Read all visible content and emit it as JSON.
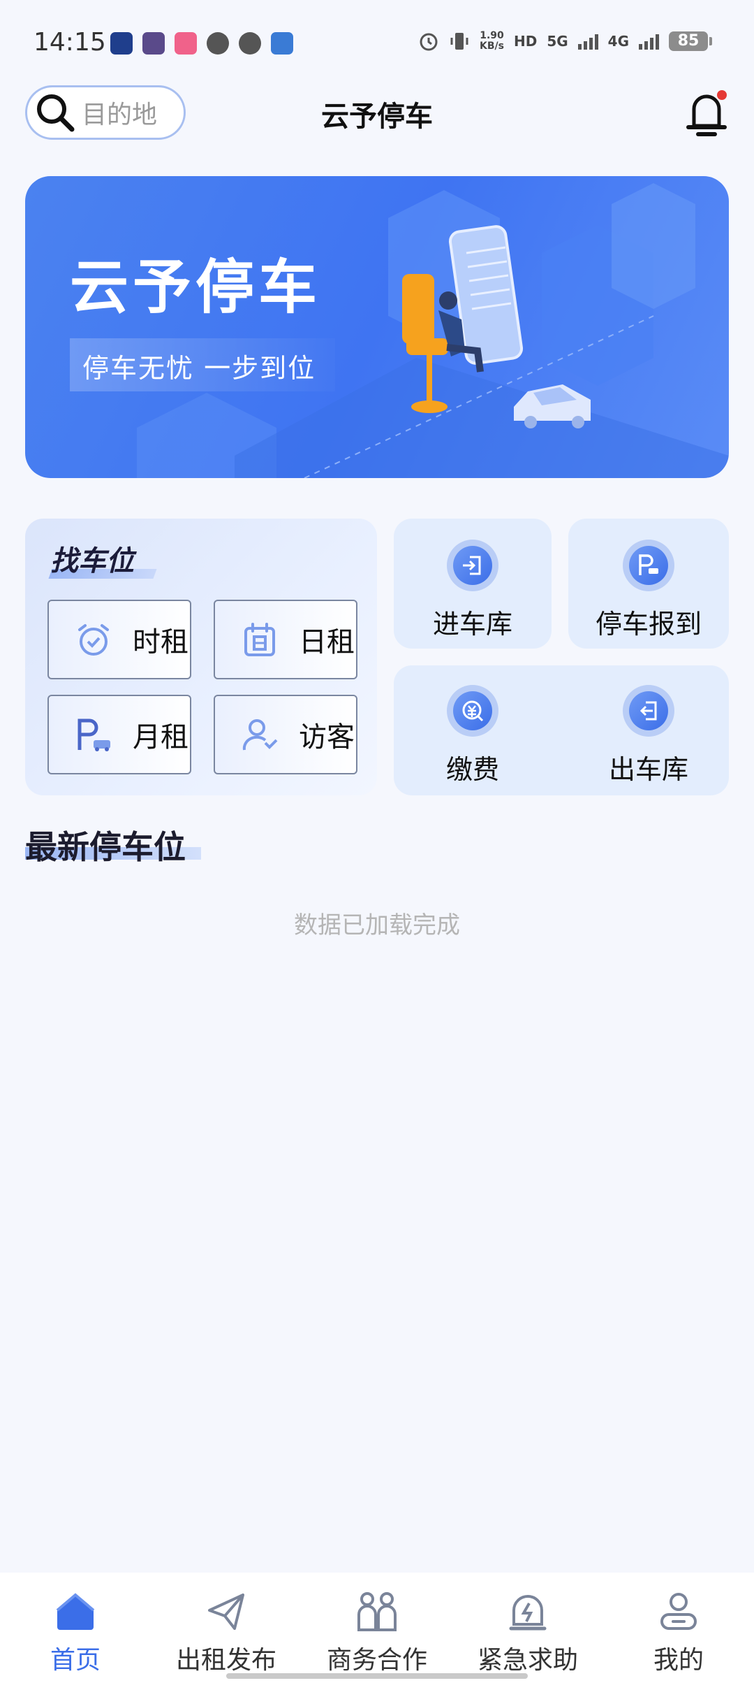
{
  "status_bar": {
    "time": "14:15",
    "net_speed_value": "1.90",
    "net_speed_unit": "KB/s",
    "hd_label": "HD",
    "sim1_label": "5G",
    "sim2_label": "4G",
    "battery": "85"
  },
  "header": {
    "search_placeholder": "目的地",
    "title": "云予停车"
  },
  "banner": {
    "title": "云予停车",
    "subtitle": "停车无忧 一步到位"
  },
  "find_parking": {
    "title": "找车位",
    "options": [
      {
        "label": "时租",
        "icon": "alarm-clock-icon"
      },
      {
        "label": "日租",
        "icon": "calendar-icon"
      },
      {
        "label": "月租",
        "icon": "parking-car-icon"
      },
      {
        "label": "访客",
        "icon": "visitor-icon"
      }
    ]
  },
  "quick_actions": [
    {
      "label": "进车库",
      "icon": "enter-garage-icon"
    },
    {
      "label": "停车报到",
      "icon": "parking-checkin-icon"
    },
    {
      "label": "缴费",
      "icon": "payment-icon"
    },
    {
      "label": "出车库",
      "icon": "exit-garage-icon"
    }
  ],
  "latest": {
    "title": "最新停车位",
    "empty_text": "数据已加载完成"
  },
  "bottom_nav": [
    {
      "label": "首页",
      "icon": "home-icon",
      "active": true
    },
    {
      "label": "出租发布",
      "icon": "paper-plane-icon",
      "active": false
    },
    {
      "label": "商务合作",
      "icon": "partners-icon",
      "active": false
    },
    {
      "label": "紧急求助",
      "icon": "emergency-icon",
      "active": false
    },
    {
      "label": "我的",
      "icon": "profile-icon",
      "active": false
    }
  ],
  "colors": {
    "accent": "#3b6ee8",
    "background": "#f5f7fd",
    "banner": "#4b82f0",
    "notification_dot": "#e53935"
  }
}
